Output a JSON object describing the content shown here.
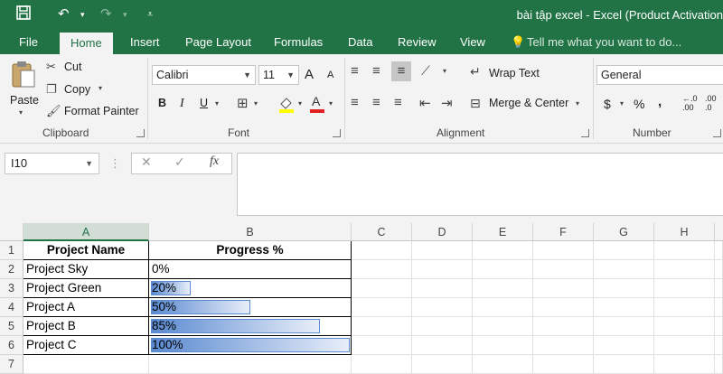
{
  "titlebar": {
    "title": "bài tập excel - Excel (Product Activation",
    "save_icon": "save-icon",
    "undo_icon": "undo-icon",
    "redo_icon": "redo-icon",
    "customize_icon": "customize-qat-icon"
  },
  "tabs": [
    "File",
    "Home",
    "Insert",
    "Page Layout",
    "Formulas",
    "Data",
    "Review",
    "View"
  ],
  "active_tab": "Home",
  "tell_me": "Tell me what you want to do...",
  "ribbon": {
    "clipboard": {
      "paste": "Paste",
      "cut": "Cut",
      "copy": "Copy",
      "format_painter": "Format Painter",
      "label": "Clipboard"
    },
    "font": {
      "name": "Calibri",
      "size": "11",
      "grow": "A",
      "shrink": "A",
      "bold": "B",
      "italic": "I",
      "underline": "U",
      "label": "Font"
    },
    "alignment": {
      "wrap_text": "Wrap Text",
      "merge_center": "Merge & Center",
      "label": "Alignment"
    },
    "number": {
      "format": "General",
      "currency": "$",
      "percent": "%",
      "comma": ",",
      "inc_decimal": ".00",
      "dec_decimal": ".0",
      "label": "Number"
    }
  },
  "formula_bar": {
    "name_box": "I10",
    "cancel": "✕",
    "enter": "✓",
    "fx": "fx",
    "formula": ""
  },
  "columns": [
    "A",
    "B",
    "C",
    "D",
    "E",
    "F",
    "G",
    "H"
  ],
  "rows": [
    "1",
    "2",
    "3",
    "4",
    "5",
    "6",
    "7"
  ],
  "table": {
    "headers": [
      "Project Name",
      "Progress %"
    ],
    "rows": [
      {
        "name": "Project Sky",
        "progress": "0%",
        "fraction": 0.0
      },
      {
        "name": "Project Green",
        "progress": "20%",
        "fraction": 0.2
      },
      {
        "name": "Project A",
        "progress": "50%",
        "fraction": 0.5
      },
      {
        "name": "Project B",
        "progress": "85%",
        "fraction": 0.85
      },
      {
        "name": "Project C",
        "progress": "100%",
        "fraction": 1.0
      }
    ]
  },
  "colors": {
    "accent": "#217346",
    "databar": "#5b8bd0"
  }
}
